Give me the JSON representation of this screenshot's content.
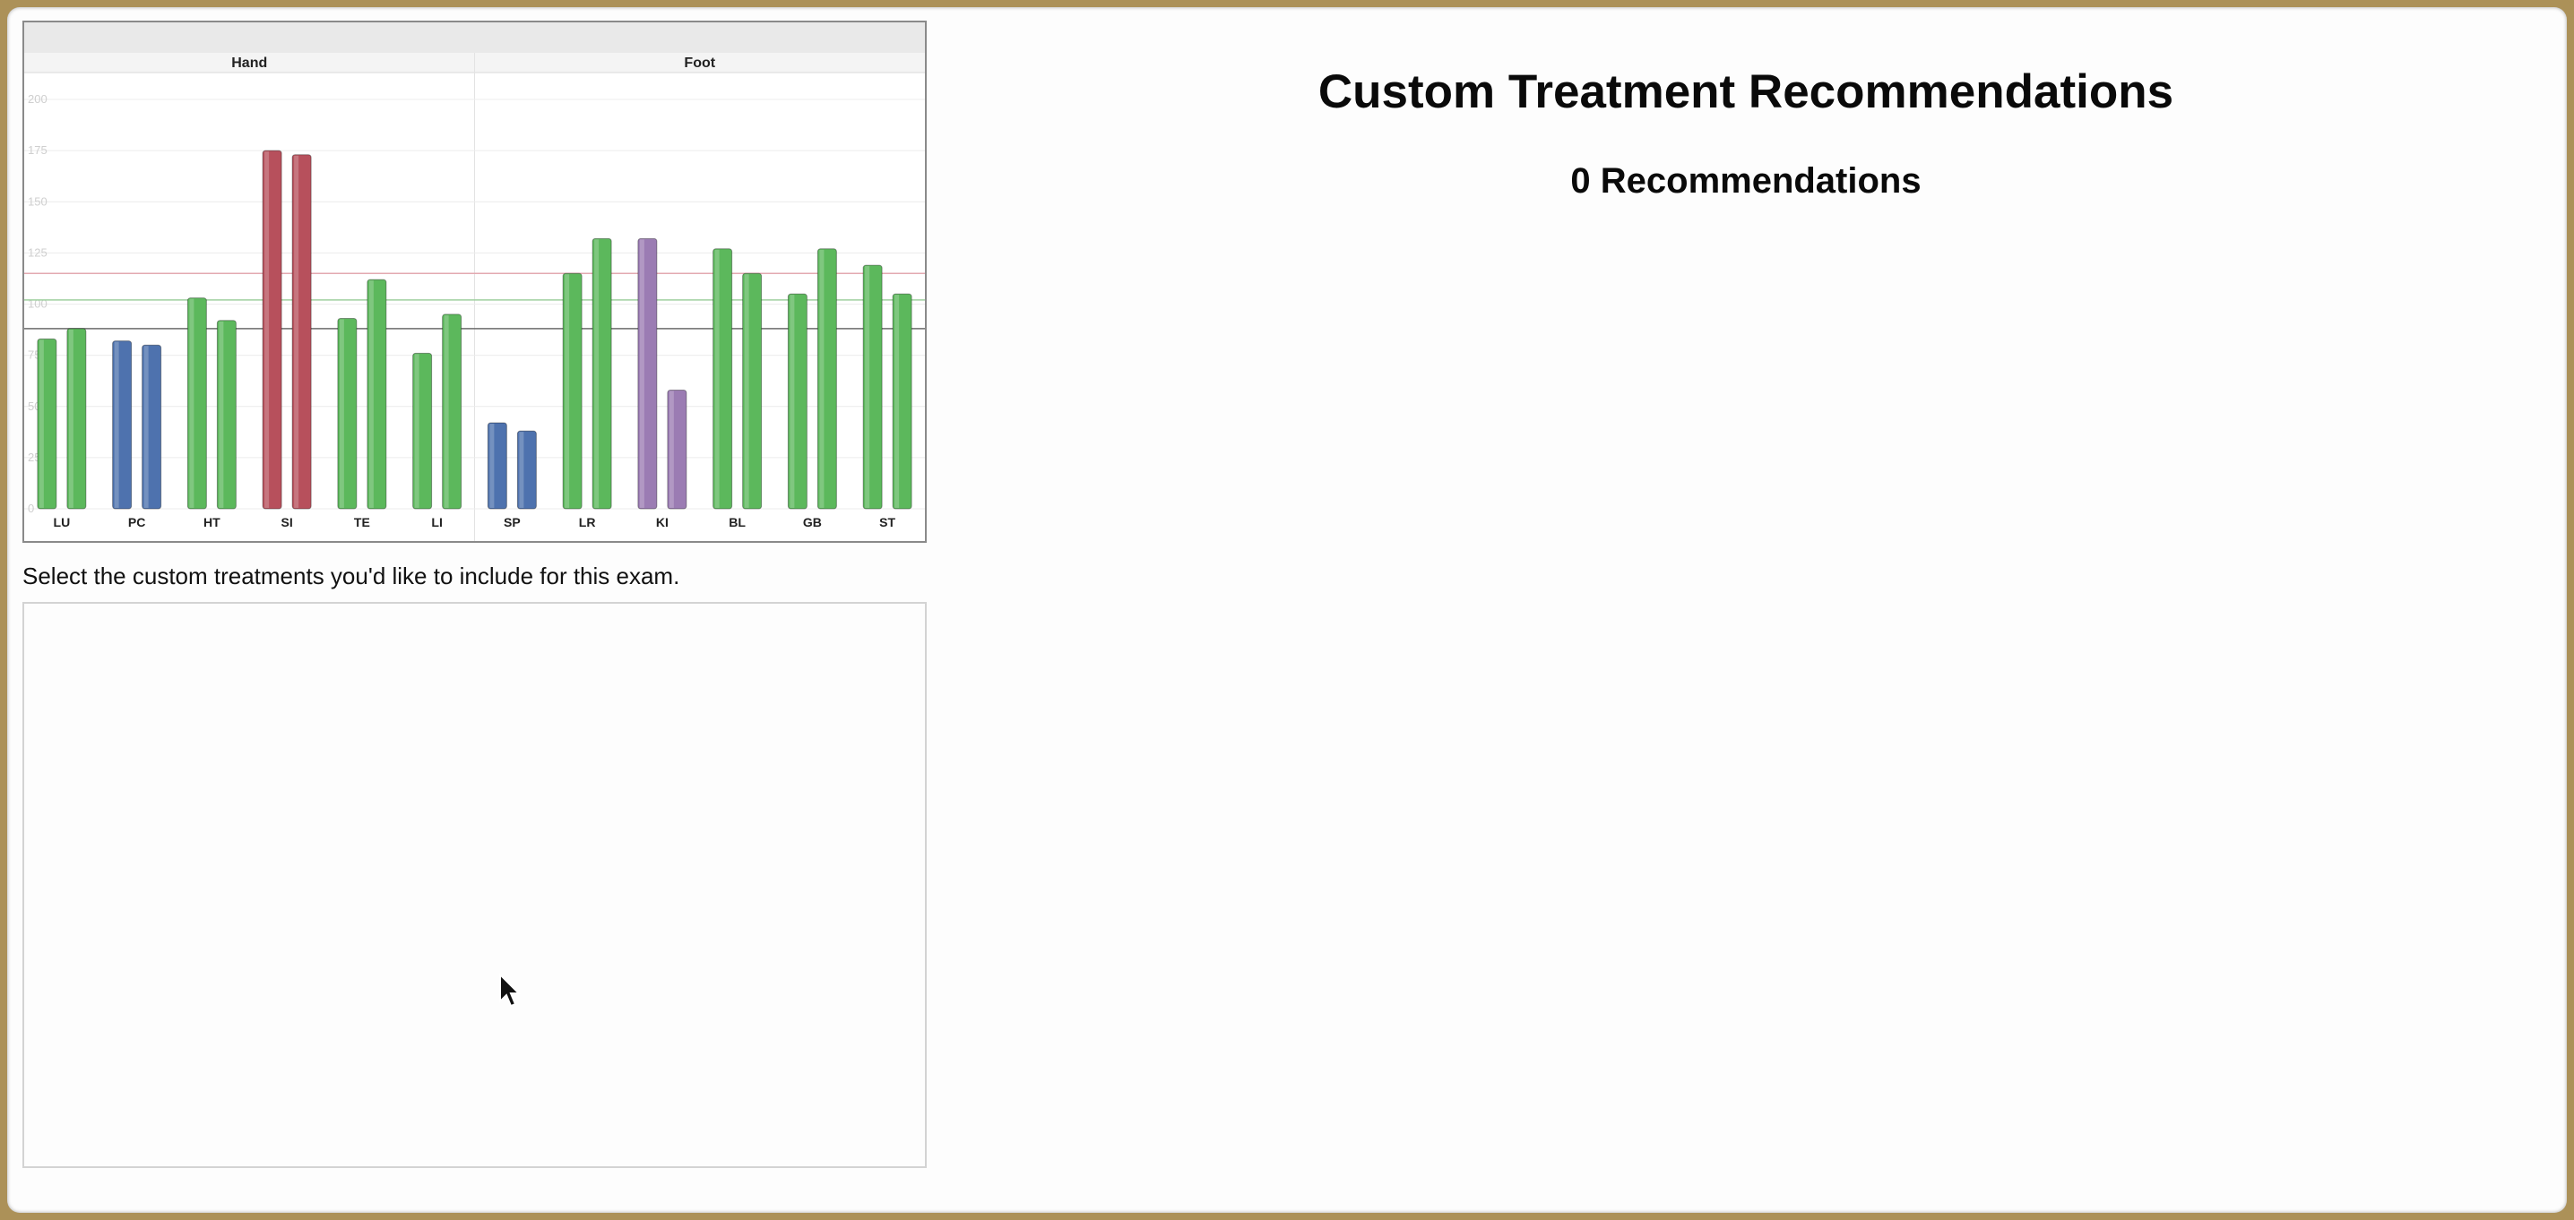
{
  "chart_data": {
    "type": "bar",
    "groups": [
      {
        "label": "Hand",
        "categories": [
          "LU",
          "PC",
          "HT",
          "SI",
          "TE",
          "LI"
        ]
      },
      {
        "label": "Foot",
        "categories": [
          "SP",
          "LR",
          "KI",
          "BL",
          "GB",
          "ST"
        ]
      }
    ],
    "categories": [
      "LU",
      "PC",
      "HT",
      "SI",
      "TE",
      "LI",
      "SP",
      "LR",
      "KI",
      "BL",
      "GB",
      "ST"
    ],
    "series": [
      {
        "values": [
          83,
          82,
          103,
          175,
          93,
          76,
          42,
          115,
          132,
          127,
          105,
          119
        ]
      },
      {
        "values": [
          88,
          80,
          92,
          173,
          112,
          95,
          38,
          132,
          58,
          115,
          127,
          105
        ]
      }
    ],
    "bar_colors": [
      [
        "#5cb85c",
        "#5cb85c"
      ],
      [
        "#4e72ae",
        "#4e72ae"
      ],
      [
        "#5cb85c",
        "#5cb85c"
      ],
      [
        "#b7505c",
        "#b7505c"
      ],
      [
        "#5cb85c",
        "#5cb85c"
      ],
      [
        "#5cb85c",
        "#5cb85c"
      ],
      [
        "#4e72ae",
        "#4e72ae"
      ],
      [
        "#5cb85c",
        "#5cb85c"
      ],
      [
        "#9b7cb3",
        "#9b7cb3"
      ],
      [
        "#5cb85c",
        "#5cb85c"
      ],
      [
        "#5cb85c",
        "#5cb85c"
      ],
      [
        "#5cb85c",
        "#5cb85c"
      ]
    ],
    "yticks": [
      0,
      25,
      50,
      75,
      100,
      125,
      150,
      175,
      200
    ],
    "ylim": [
      0,
      200
    ],
    "reference_lines": [
      {
        "value": 88,
        "color": "#6b6b6b"
      },
      {
        "value": 102,
        "color": "#9fd09f"
      },
      {
        "value": 115,
        "color": "#e3a9b0"
      }
    ],
    "grid": true,
    "legend": "none"
  },
  "instruction_text": "Select the custom treatments you'd like to include for this exam.",
  "recommendations": {
    "title": "Custom Treatment Recommendations",
    "count_label": "0 Recommendations"
  }
}
